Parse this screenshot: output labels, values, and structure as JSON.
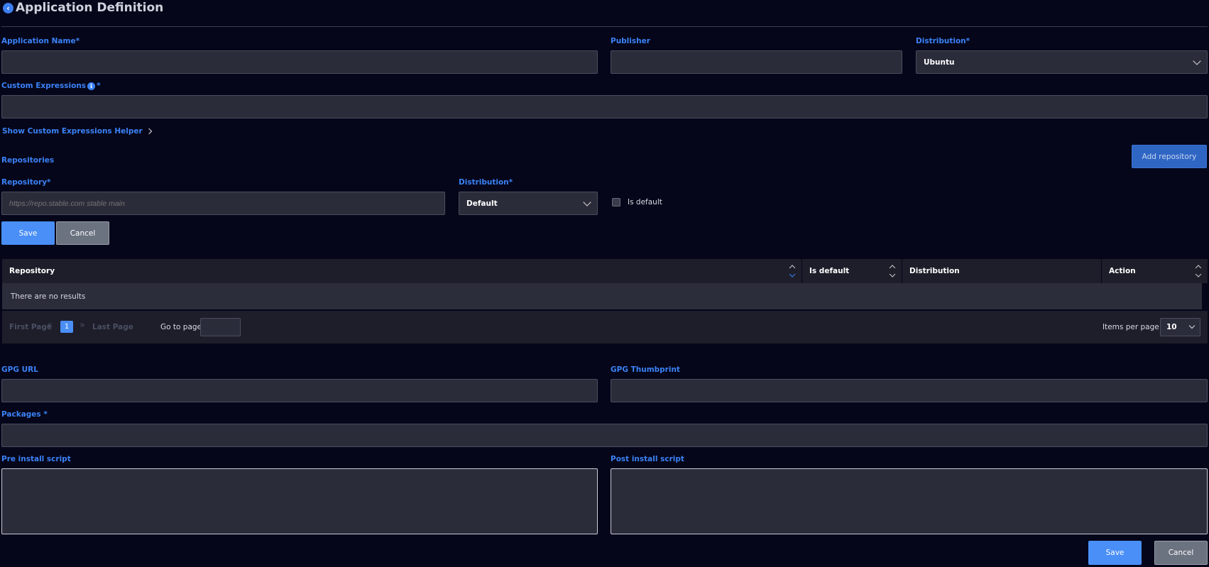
{
  "page": {
    "title": "Application Definition"
  },
  "form": {
    "app_name": {
      "label": "Application Name*",
      "value": ""
    },
    "publisher": {
      "label": "Publisher",
      "value": ""
    },
    "distribution": {
      "label": "Distribution*",
      "value": "Ubuntu"
    },
    "custom_expressions": {
      "label": "Custom Expressions",
      "info": "i",
      "required": "*",
      "value": ""
    },
    "helper_link": "Show Custom Expressions Helper",
    "gpg_url": {
      "label": "GPG URL",
      "value": ""
    },
    "gpg_thumbprint": {
      "label": "GPG Thumbprint",
      "value": ""
    },
    "packages": {
      "label": "Packages *",
      "value": ""
    },
    "pre_install": {
      "label": "Pre install script",
      "value": ""
    },
    "post_install": {
      "label": "Post install script",
      "value": ""
    },
    "save_label": "Save",
    "cancel_label": "Cancel"
  },
  "repositories": {
    "heading": "Repositories",
    "add_button": "Add repository",
    "repository": {
      "label": "Repository*",
      "placeholder": "https://repo.stable.com stable main"
    },
    "distribution": {
      "label": "Distribution*",
      "value": "Default"
    },
    "is_default_label": "Is default",
    "save_label": "Save",
    "cancel_label": "Cancel",
    "table": {
      "columns": [
        "Repository",
        "Is default",
        "Distribution",
        "Action"
      ],
      "empty_text": "There are no results"
    },
    "pagination": {
      "first": "First Page",
      "last": "Last Page",
      "current_page": "1",
      "goto_label": "Go to page:",
      "goto_value": "",
      "items_per_page_label": "Items per page:",
      "items_per_page": "10"
    }
  },
  "colors": {
    "background": "#05061a",
    "accent": "#3b82f6",
    "primary_button": "#4a8ff7",
    "field": "#2b2c3a"
  }
}
